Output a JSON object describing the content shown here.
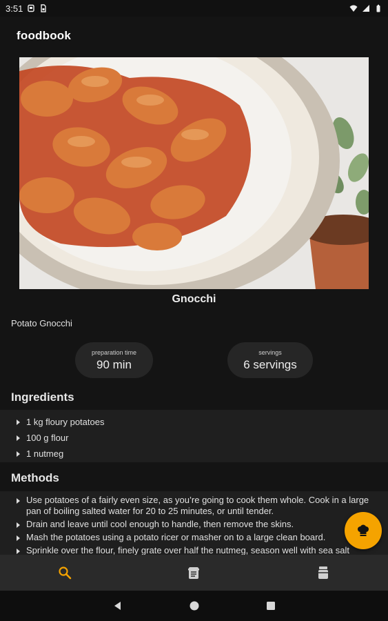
{
  "status_bar": {
    "time": "3:51",
    "icons": [
      "android-icon",
      "sim-icon",
      "wifi-icon",
      "cellular-icon",
      "battery-icon"
    ]
  },
  "app": {
    "brand": "foodbook"
  },
  "recipe": {
    "image": "gnocchi-photo",
    "title": "Gnocchi",
    "subtitle": "Potato Gnocchi",
    "prep_label": "preparation time",
    "prep_value": "90 min",
    "servings_label": "servings",
    "servings_value": "6 servings"
  },
  "ingredients": {
    "title": "Ingredients",
    "items": [
      "1 kg floury potatoes",
      "100 g flour",
      "1 nutmeg"
    ]
  },
  "methods": {
    "title": "Methods",
    "items": [
      "Use potatoes of a fairly even size, as you’re going to cook them whole. Cook in a large pan of boiling salted water for 20 to 25 minutes, or until tender.",
      "Drain and leave until cool enough to handle, then remove the skins.",
      "Mash the potatoes using a potato ricer or masher on to a large clean board.",
      "Sprinkle over the flour, finely grate over half the nutmeg, season well with sea salt"
    ]
  },
  "fab": {
    "icon": "chef-hat-icon"
  },
  "bottom_nav": {
    "items": [
      {
        "icon": "search-icon",
        "active": true
      },
      {
        "icon": "recipe-book-icon",
        "active": false
      },
      {
        "icon": "pantry-jar-icon",
        "active": false
      }
    ]
  },
  "system_nav": {
    "icons": [
      "back-icon",
      "home-icon",
      "recents-icon"
    ]
  },
  "colors": {
    "background": "#141414",
    "panel": "#1f1f1f",
    "pill": "#262626",
    "accent": "#f5a300",
    "bottom_nav": "#2a2a2a"
  }
}
